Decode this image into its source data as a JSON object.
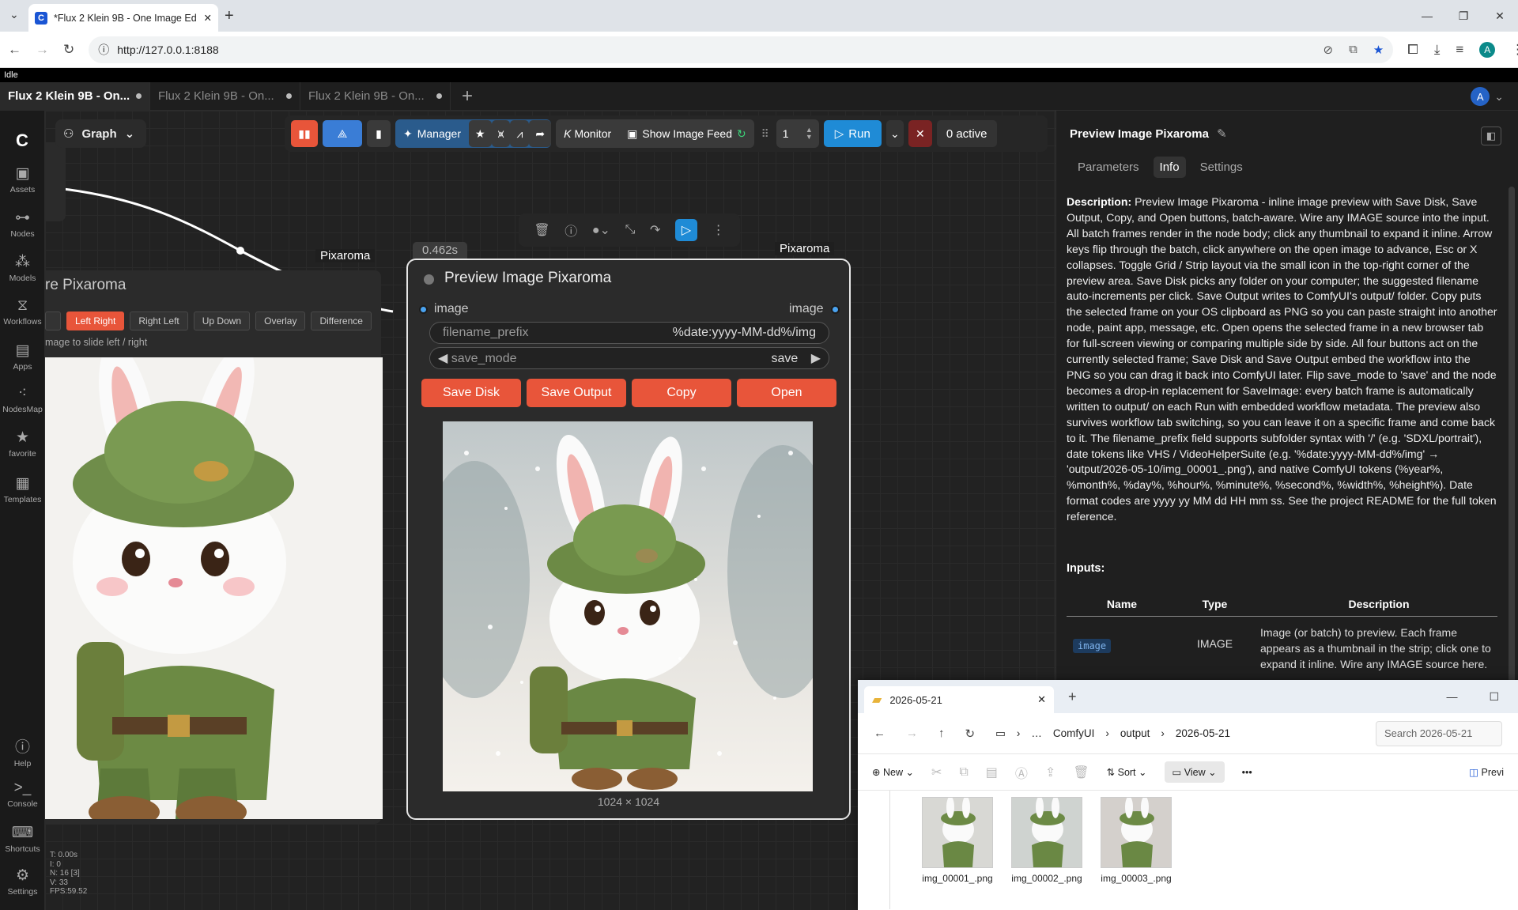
{
  "browser": {
    "tab_title": "*Flux 2 Klein 9B - One Image Ed",
    "url": "http://127.0.0.1:8188",
    "profile_initial": "A"
  },
  "status": {
    "text": "Idle"
  },
  "workflow_tabs": [
    {
      "label": "Flux 2 Klein 9B - On...",
      "active": true
    },
    {
      "label": "Flux 2 Klein 9B - On...",
      "active": false
    },
    {
      "label": "Flux 2 Klein 9B - On...",
      "active": false
    }
  ],
  "account_initial": "A",
  "sidebar": [
    {
      "label": "Assets"
    },
    {
      "label": "Nodes"
    },
    {
      "label": "Models"
    },
    {
      "label": "Workflows"
    },
    {
      "label": "Apps"
    },
    {
      "label": "NodesMap"
    },
    {
      "label": "favorite"
    },
    {
      "label": "Templates"
    },
    {
      "label": "Help"
    },
    {
      "label": "Console"
    },
    {
      "label": "Shortcuts"
    },
    {
      "label": "Settings"
    }
  ],
  "graph_button": "Graph",
  "actionbar": {
    "manager": "Manager",
    "monitor": "Monitor",
    "show_feed": "Show Image Feed",
    "count": "1",
    "run": "Run",
    "active": "0 active"
  },
  "node_compare": {
    "title": "re Pixaroma",
    "badge": "Pixaroma",
    "modes": [
      {
        "label": "Left Right",
        "active": true
      },
      {
        "label": "Right Left",
        "active": false
      },
      {
        "label": "Up Down",
        "active": false
      },
      {
        "label": "Overlay",
        "active": false
      },
      {
        "label": "Difference",
        "active": false
      }
    ],
    "hint": "mage to slide left / right"
  },
  "node_preview": {
    "timer": "0.462s",
    "badge": "Pixaroma",
    "title": "Preview Image Pixaroma",
    "input_label": "image",
    "output_label": "image",
    "filename_prefix_label": "filename_prefix",
    "filename_prefix_value": "%date:yyyy-MM-dd%/img",
    "save_mode_label": "save_mode",
    "save_mode_value": "save",
    "buttons": [
      "Save Disk",
      "Save Output",
      "Copy",
      "Open"
    ],
    "dims": "1024 × 1024"
  },
  "right_panel": {
    "title": "Preview Image Pixaroma",
    "tabs": [
      {
        "label": "Parameters",
        "active": false
      },
      {
        "label": "Info",
        "active": true
      },
      {
        "label": "Settings",
        "active": false
      }
    ],
    "desc_label": "Description:",
    "description": " Preview Image Pixaroma - inline image preview with Save Disk, Save Output, Copy, and Open buttons, batch-aware. Wire any IMAGE source into the input. All batch frames render in the node body; click any thumbnail to expand it inline. Arrow keys flip through the batch, click anywhere on the open image to advance, Esc or X collapses. Toggle Grid / Strip layout via the small icon in the top-right corner of the preview area. Save Disk picks any folder on your computer; the suggested filename auto-increments per click. Save Output writes to ComfyUI's output/ folder. Copy puts the selected frame on your OS clipboard as PNG so you can paste straight into another node, paint app, message, etc. Open opens the selected frame in a new browser tab for full-screen viewing or comparing multiple side by side. All four buttons act on the currently selected frame; Save Disk and Save Output embed the workflow into the PNG so you can drag it back into ComfyUI later. Flip save_mode to 'save' and the node becomes a drop-in replacement for SaveImage: every batch frame is automatically written to output/ on each Run with embedded workflow metadata. The preview also survives workflow tab switching, so you can leave it on a specific frame and come back to it. The filename_prefix field supports subfolder syntax with '/' (e.g. 'SDXL/portrait'), date tokens like VHS / VideoHelperSuite (e.g. '%date:yyyy-MM-dd%/img' → 'output/2026-05-10/img_00001_.png'), and native ComfyUI tokens (%year%, %month%, %day%, %hour%, %minute%, %second%, %width%, %height%). Date format codes are yyyy yy MM dd HH mm ss. See the project README for the full token reference.",
    "inputs_header": "Inputs:",
    "table_headers": [
      "Name",
      "Type",
      "Description"
    ],
    "inputs": [
      {
        "name": "image",
        "type": "IMAGE",
        "description": "Image (or batch) to preview. Each frame appears as a thumbnail in the strip; click one to expand it inline. Wire any IMAGE source here."
      }
    ]
  },
  "explorer": {
    "tab_title": "2026-05-21",
    "breadcrumb": [
      "ComfyUI",
      "output",
      "2026-05-21"
    ],
    "search_placeholder": "Search 2026-05-21",
    "cmd_new": "New",
    "cmd_sort": "Sort",
    "cmd_view": "View",
    "cmd_preview": "Previ",
    "files": [
      "img_00001_.png",
      "img_00002_.png",
      "img_00003_.png"
    ]
  },
  "stats": [
    "T: 0.00s",
    "I: 0",
    "N: 16 [3]",
    "V: 33",
    "FPS:59.52"
  ],
  "colors": {
    "accent_orange": "#e8553a",
    "run_blue": "#1f8bd6",
    "slot_blue": "#4aa3f0"
  }
}
